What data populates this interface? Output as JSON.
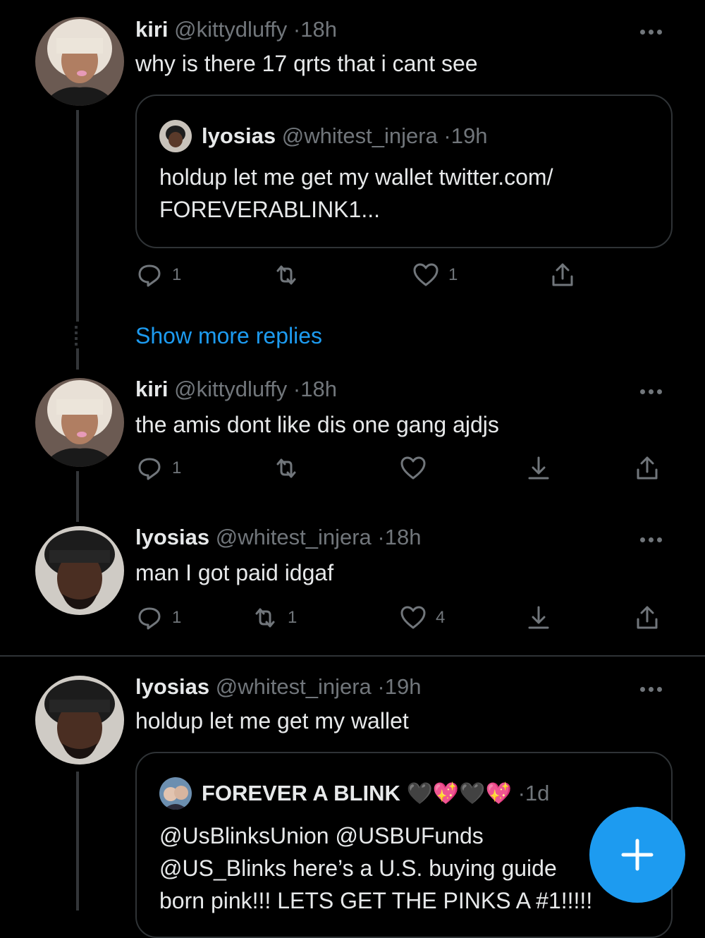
{
  "tweets": [
    {
      "name": "kiri",
      "handle": "@kittydluffy",
      "sep": "·",
      "time": "18h",
      "text": "why is there 17 qrts that i cant see",
      "quote": {
        "name": "lyosias",
        "handle": "@whitest_injera",
        "sep": "·",
        "time": "19h",
        "line1": "holdup let me get my wallet twitter.com/",
        "line2": "FOREVERABLINK1..."
      },
      "reply_count": "1",
      "like_count": "1"
    },
    {
      "name": "kiri",
      "handle": "@kittydluffy",
      "sep": "·",
      "time": "18h",
      "text": "the amis dont like dis one gang ajdjs",
      "reply_count": "1"
    },
    {
      "name": "lyosias",
      "handle": "@whitest_injera",
      "sep": "·",
      "time": "18h",
      "text": "man I got paid idgaf",
      "reply_count": "1",
      "retweet_count": "1",
      "like_count": "4"
    },
    {
      "name": "lyosias",
      "handle": "@whitest_injera",
      "sep": "·",
      "time": "19h",
      "text": "holdup let me get my wallet",
      "quote": {
        "name": "FOREVER A BLINK",
        "emoji": "🖤💖🖤💖",
        "sep": "·",
        "time": "1d",
        "line1": "@UsBlinksUnion @USBUFunds",
        "line2": "@US_Blinks here’s a U.S. buying guide",
        "line3": "born pink!!! LETS GET THE PINKS A #1!!!!!"
      }
    }
  ],
  "show_more_replies": "Show more replies",
  "colors": {
    "background": "#000000",
    "accent": "#1d9bf0",
    "muted": "#71767b",
    "text": "#e7e9ea",
    "border": "#2f3336"
  }
}
